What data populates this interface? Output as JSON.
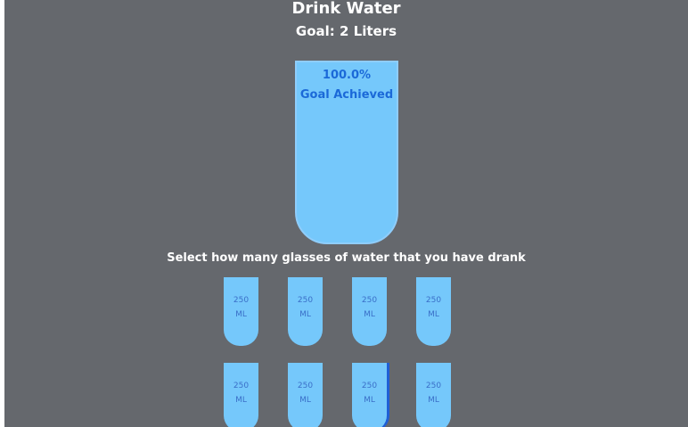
{
  "header": {
    "title": "Drink Water",
    "subtitle": "Goal: 2 Liters"
  },
  "big_cup": {
    "percentage": "100.0%",
    "status": "Goal Achieved",
    "fill_fraction": 1.0
  },
  "instruction": "Select how many glasses of water that you have drank",
  "cups": [
    {
      "amount": "250",
      "unit": "ML",
      "filled": true
    },
    {
      "amount": "250",
      "unit": "ML",
      "filled": true
    },
    {
      "amount": "250",
      "unit": "ML",
      "filled": true
    },
    {
      "amount": "250",
      "unit": "ML",
      "filled": true
    },
    {
      "amount": "250",
      "unit": "ML",
      "filled": true
    },
    {
      "amount": "250",
      "unit": "ML",
      "filled": true
    },
    {
      "amount": "250",
      "unit": "ML",
      "filled": true,
      "focused": true
    },
    {
      "amount": "250",
      "unit": "ML",
      "filled": true
    }
  ],
  "colors": {
    "background": "#65686d",
    "water": "#75c8fb",
    "text_accent": "#1b69d8",
    "focus_ring": "#1f5fd6"
  }
}
